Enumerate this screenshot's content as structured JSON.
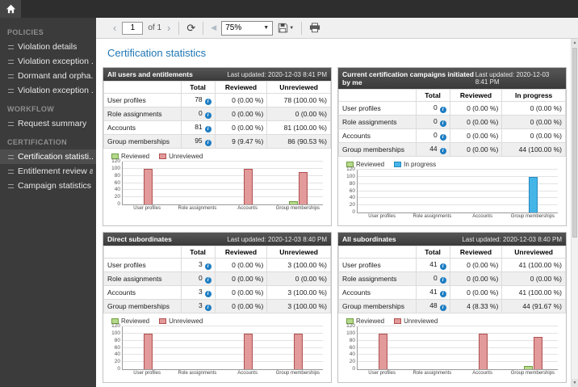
{
  "page": {
    "title": "Certification statistics"
  },
  "icons": {
    "prev": "‹",
    "next": "›",
    "refresh": "⟳",
    "back": "◀",
    "caret_down": "▼",
    "info": "i",
    "up_arrow": "▲",
    "down_arrow": "▼"
  },
  "toolbar": {
    "page_value": "1",
    "of_label": "of 1",
    "zoom_value": "75%"
  },
  "sidebar": {
    "sections": [
      {
        "label": "POLICIES",
        "items": [
          {
            "label": "Violation details",
            "selected": false
          },
          {
            "label": "Violation exception ...",
            "selected": false
          },
          {
            "label": "Dormant and orpha...",
            "selected": false
          },
          {
            "label": "Violation exception ...",
            "selected": false
          }
        ]
      },
      {
        "label": "WORKFLOW",
        "items": [
          {
            "label": "Request summary",
            "selected": false
          }
        ]
      },
      {
        "label": "CERTIFICATION",
        "items": [
          {
            "label": "Certification statisti...",
            "selected": true
          },
          {
            "label": "Entitlement review a...",
            "selected": false
          },
          {
            "label": "Campaign statistics",
            "selected": false
          }
        ]
      }
    ]
  },
  "panels": [
    {
      "title": "All users and entitlements",
      "last_updated": "Last updated: 2020-12-03 8:41 PM",
      "columns": [
        "Total",
        "Reviewed",
        "Unreviewed"
      ],
      "rows": [
        [
          "User profiles",
          "78",
          "0 (0.00 %)",
          "78 (100.00 %)"
        ],
        [
          "Role assignments",
          "0",
          "0 (0.00 %)",
          "0 (0.00 %)"
        ],
        [
          "Accounts",
          "81",
          "0 (0.00 %)",
          "81 (100.00 %)"
        ],
        [
          "Group memberships",
          "95",
          "9 (9.47 %)",
          "86 (90.53 %)"
        ]
      ]
    },
    {
      "title": "Current certification campaigns initiated by me",
      "last_updated": "Last updated: 2020-12-03 8:41 PM",
      "columns": [
        "Total",
        "Reviewed",
        "In progress"
      ],
      "rows": [
        [
          "User profiles",
          "0",
          "0 (0.00 %)",
          "0 (0.00 %)"
        ],
        [
          "Role assignments",
          "0",
          "0 (0.00 %)",
          "0 (0.00 %)"
        ],
        [
          "Accounts",
          "0",
          "0 (0.00 %)",
          "0 (0.00 %)"
        ],
        [
          "Group memberships",
          "44",
          "0 (0.00 %)",
          "44 (100.00 %)"
        ]
      ]
    },
    {
      "title": "Direct subordinates",
      "last_updated": "Last updated: 2020-12-03 8:40 PM",
      "columns": [
        "Total",
        "Reviewed",
        "Unreviewed"
      ],
      "rows": [
        [
          "User profiles",
          "3",
          "0 (0.00 %)",
          "3 (100.00 %)"
        ],
        [
          "Role assignments",
          "0",
          "0 (0.00 %)",
          "0 (0.00 %)"
        ],
        [
          "Accounts",
          "3",
          "0 (0.00 %)",
          "3 (100.00 %)"
        ],
        [
          "Group memberships",
          "3",
          "0 (0.00 %)",
          "3 (100.00 %)"
        ]
      ]
    },
    {
      "title": "All subordinates",
      "last_updated": "Last updated: 2020-12-03 8:40 PM",
      "columns": [
        "Total",
        "Reviewed",
        "Unreviewed"
      ],
      "rows": [
        [
          "User profiles",
          "41",
          "0 (0.00 %)",
          "41 (100.00 %)"
        ],
        [
          "Role assignments",
          "0",
          "0 (0.00 %)",
          "0 (0.00 %)"
        ],
        [
          "Accounts",
          "41",
          "0 (0.00 %)",
          "41 (100.00 %)"
        ],
        [
          "Group memberships",
          "48",
          "4 (8.33 %)",
          "44 (91.67 %)"
        ]
      ]
    }
  ],
  "chart_data": [
    {
      "type": "bar",
      "title": "All users and entitlements",
      "categories": [
        "User profiles",
        "Role assignments",
        "Accounts",
        "Group memberships"
      ],
      "series": [
        {
          "name": "Reviewed",
          "values": [
            0,
            0,
            0,
            9.47
          ],
          "fill": "#b5d98a",
          "border": "#6f9e3f"
        },
        {
          "name": "Unreviewed",
          "values": [
            100,
            0,
            100,
            90.53
          ],
          "fill": "#e29a9a",
          "border": "#b05050"
        }
      ],
      "unit": "percent",
      "ylim": [
        0,
        120
      ],
      "yticks": [
        0,
        20,
        40,
        60,
        80,
        100,
        120
      ],
      "grid": true,
      "legend_position": "top-left"
    },
    {
      "type": "bar",
      "title": "Current certification campaigns initiated by me",
      "categories": [
        "User profiles",
        "Role assignments",
        "Accounts",
        "Group memberships"
      ],
      "series": [
        {
          "name": "Reviewed",
          "values": [
            0,
            0,
            0,
            0
          ],
          "fill": "#b5d98a",
          "border": "#6f9e3f"
        },
        {
          "name": "In progress",
          "values": [
            0,
            0,
            0,
            100
          ],
          "fill": "#45b5e8",
          "border": "#2589bd"
        }
      ],
      "unit": "percent",
      "ylim": [
        0,
        120
      ],
      "yticks": [
        0,
        20,
        40,
        60,
        80,
        100,
        120
      ],
      "grid": true,
      "legend_position": "top-left"
    },
    {
      "type": "bar",
      "title": "Direct subordinates",
      "categories": [
        "User profiles",
        "Role assignments",
        "Accounts",
        "Group memberships"
      ],
      "series": [
        {
          "name": "Reviewed",
          "values": [
            0,
            0,
            0,
            0
          ],
          "fill": "#b5d98a",
          "border": "#6f9e3f"
        },
        {
          "name": "Unreviewed",
          "values": [
            100,
            0,
            100,
            100
          ],
          "fill": "#e29a9a",
          "border": "#b05050"
        }
      ],
      "unit": "percent",
      "ylim": [
        0,
        120
      ],
      "yticks": [
        0,
        20,
        40,
        60,
        80,
        100,
        120
      ],
      "grid": true,
      "legend_position": "top-left"
    },
    {
      "type": "bar",
      "title": "All subordinates",
      "categories": [
        "User profiles",
        "Role assignments",
        "Accounts",
        "Group memberships"
      ],
      "series": [
        {
          "name": "Reviewed",
          "values": [
            0,
            0,
            0,
            8.33
          ],
          "fill": "#b5d98a",
          "border": "#6f9e3f"
        },
        {
          "name": "Unreviewed",
          "values": [
            100,
            0,
            100,
            91.67
          ],
          "fill": "#e29a9a",
          "border": "#b05050"
        }
      ],
      "unit": "percent",
      "ylim": [
        0,
        120
      ],
      "yticks": [
        0,
        20,
        40,
        60,
        80,
        100,
        120
      ],
      "grid": true,
      "legend_position": "top-left"
    }
  ]
}
